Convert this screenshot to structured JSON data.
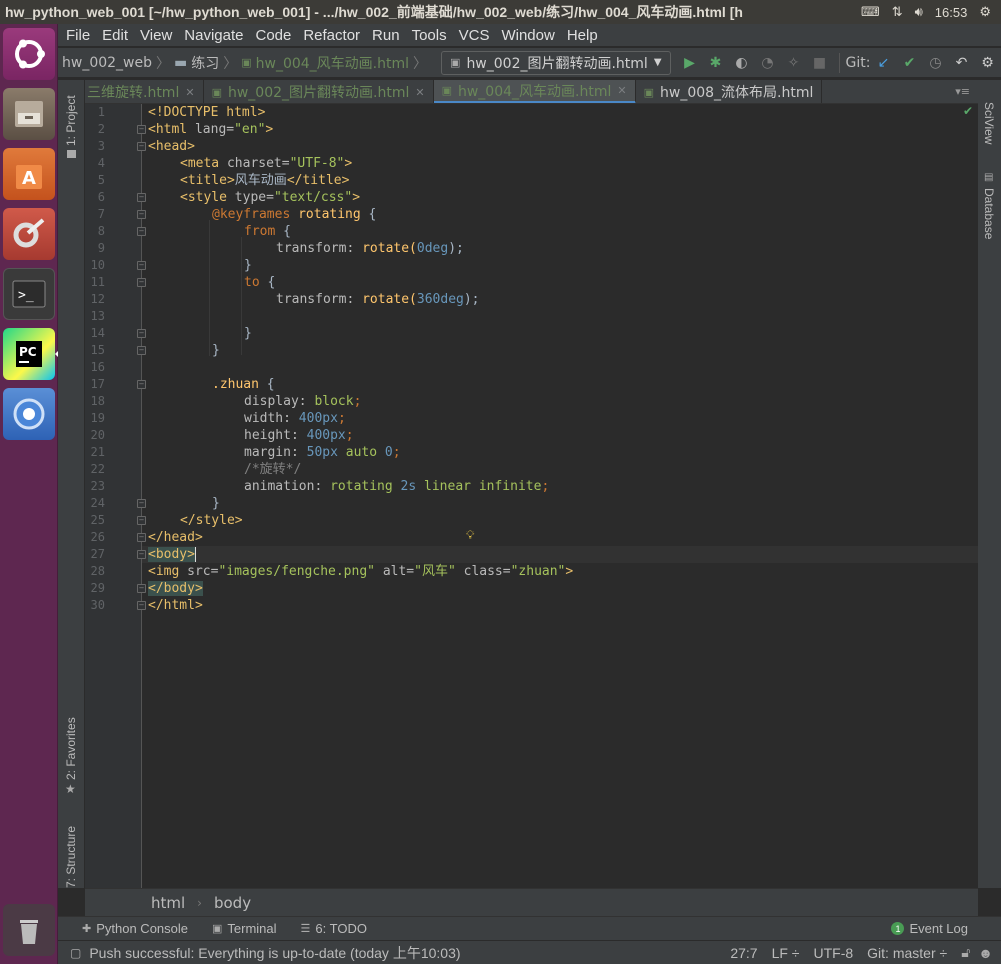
{
  "os": {
    "window_title": "hw_python_web_001 [~/hw_python_web_001] - .../hw_002_前端基础/hw_002_web/练习/hw_004_风车动画.html [h",
    "clock": "16:53",
    "tray_icons": [
      "keyboard-icon",
      "network-icon",
      "volume-icon",
      "power-icon"
    ]
  },
  "launcher": {
    "items": [
      "ubuntu-dash",
      "files",
      "software-center",
      "system-settings",
      "terminal",
      "pycharm",
      "chromium",
      "trash"
    ]
  },
  "menu": [
    "File",
    "Edit",
    "View",
    "Navigate",
    "Code",
    "Refactor",
    "Run",
    "Tools",
    "VCS",
    "Window",
    "Help"
  ],
  "nav": {
    "crumb1": "hw_002_web",
    "crumb2": "练习",
    "crumb3": "hw_004_风车动画.html",
    "run_config": "hw_002_图片翻转动画.html",
    "git_label": "Git:"
  },
  "side": {
    "project": "1: Project",
    "favorites": "2: Favorites",
    "structure": "7: Structure",
    "sciview": "SciView",
    "database": "Database"
  },
  "tabs": [
    {
      "label": "三维旋转.html",
      "active": false
    },
    {
      "label": "hw_002_图片翻转动画.html",
      "active": false
    },
    {
      "label": "hw_004_风车动画.html",
      "active": true
    },
    {
      "label": "hw_008_流体布局.html",
      "active": false
    }
  ],
  "line_numbers": [
    "1",
    "2",
    "3",
    "4",
    "5",
    "6",
    "7",
    "8",
    "9",
    "10",
    "11",
    "12",
    "13",
    "14",
    "15",
    "16",
    "17",
    "18",
    "19",
    "20",
    "21",
    "22",
    "23",
    "24",
    "25",
    "26",
    "27",
    "28",
    "29",
    "30"
  ],
  "code": {
    "l1": "<!DOCTYPE html>",
    "l2a": "<html ",
    "l2b": "lang=",
    "l2c": "\"en\"",
    "l2d": ">",
    "l3": "<head>",
    "l4a": "<meta ",
    "l4b": "charset=",
    "l4c": "\"UTF-8\"",
    "l4d": ">",
    "l5a": "<title>",
    "l5b": "风车动画",
    "l5c": "</title>",
    "l6a": "<style ",
    "l6b": "type=",
    "l6c": "\"text/css\"",
    "l6d": ">",
    "l7a": "@keyframes ",
    "l7b": "rotating",
    "l7c": " {",
    "l8a": "from",
    "l8b": " {",
    "l9a": "transform: ",
    "l9b": "rotate(",
    "l9c": "0deg",
    "l9d": ");",
    "l10": "}",
    "l11a": "to",
    "l11b": " {",
    "l12a": "transform: ",
    "l12b": "rotate(",
    "l12c": "360deg",
    "l12d": ");",
    "l14": "}",
    "l15": "}",
    "l17a": ".zhuan",
    "l17b": " {",
    "l18a": "display: ",
    "l18b": "block",
    "l18c": ";",
    "l19a": "width: ",
    "l19b": "400px",
    "l19c": ";",
    "l20a": "height: ",
    "l20b": "400px",
    "l20c": ";",
    "l21a": "margin: ",
    "l21b": "50px",
    "l21c": " auto ",
    "l21d": "0",
    "l21e": ";",
    "l22": "/*旋转*/",
    "l23a": "animation: ",
    "l23b": "rotating ",
    "l23c": "2s",
    "l23d": " linear infinite",
    "l23e": ";",
    "l24": "}",
    "l25": "</style>",
    "l26": "</head>",
    "l27": "<body>",
    "l28a": "<img ",
    "l28b": "src=",
    "l28c": "\"images/fengche.png\"",
    "l28d": " alt=",
    "l28e": "\"风车\"",
    "l28f": " class=",
    "l28g": "\"zhuan\"",
    "l28h": ">",
    "l29": "</body>",
    "l30": "</html>"
  },
  "breadcrumb": [
    "html",
    "body"
  ],
  "toolwindows": {
    "python_console": "Python Console",
    "terminal": "Terminal",
    "todo": "6: TODO",
    "event_log": "Event Log",
    "event_count": "1"
  },
  "status": {
    "message": "Push successful: Everything is up-to-date (today 上午10:03)",
    "position": "27:7",
    "line_sep": "LF ÷",
    "encoding": "UTF-8",
    "git_branch": "Git: master ÷"
  }
}
